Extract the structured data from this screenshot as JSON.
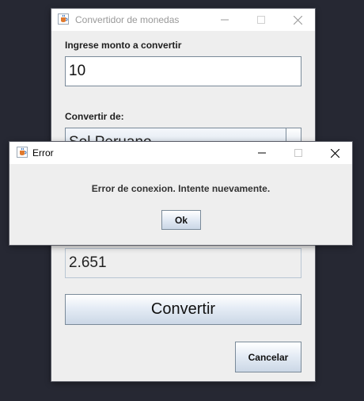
{
  "main_window": {
    "title": "Convertidor de monedas",
    "amount_label": "Ingrese monto a convertir",
    "amount_value": "10",
    "from_label": "Convertir de:",
    "from_value": "Sol Peruano",
    "result_value": "2.651",
    "convert_label": "Convertir",
    "cancel_label": "Cancelar"
  },
  "error_dialog": {
    "title": "Error",
    "message": "Error de conexion. Intente nuevamente.",
    "ok_label": "Ok"
  }
}
